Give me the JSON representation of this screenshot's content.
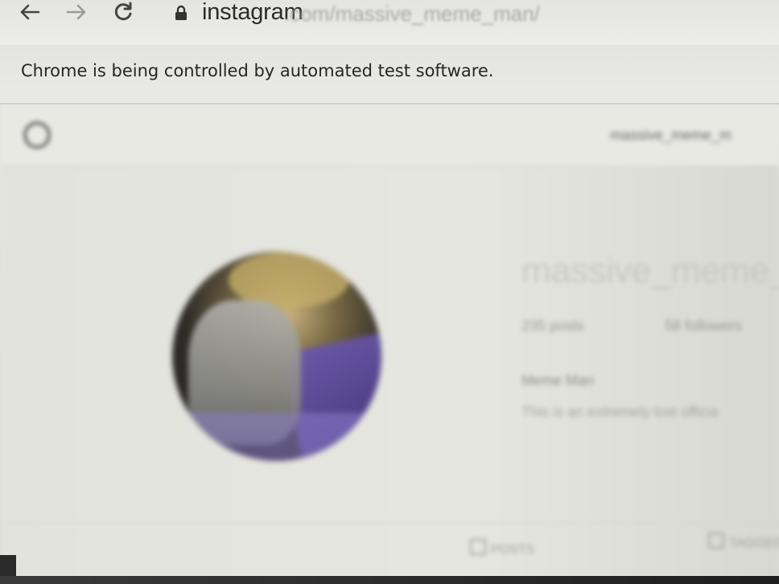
{
  "browser": {
    "back_icon": "arrow-left-icon",
    "forward_icon": "arrow-right-icon",
    "reload_icon": "reload-icon",
    "lock_icon": "lock-icon",
    "url_host": "instagram",
    "url_path": ".com/massive_meme_man/"
  },
  "infobar": {
    "message": "Chrome is being controlled by automated test software."
  },
  "instagram": {
    "logo_icon": "instagram-logo-icon",
    "header_username": "massive_meme_m",
    "profile": {
      "username": "massive_meme_m",
      "posts": "235 posts",
      "followers": "58 followers",
      "full_name": "Meme Man",
      "bio": "This is an extremely lost officia"
    },
    "tabs": {
      "posts_label": "POSTS",
      "tagged_label": "TAGGED"
    }
  }
}
